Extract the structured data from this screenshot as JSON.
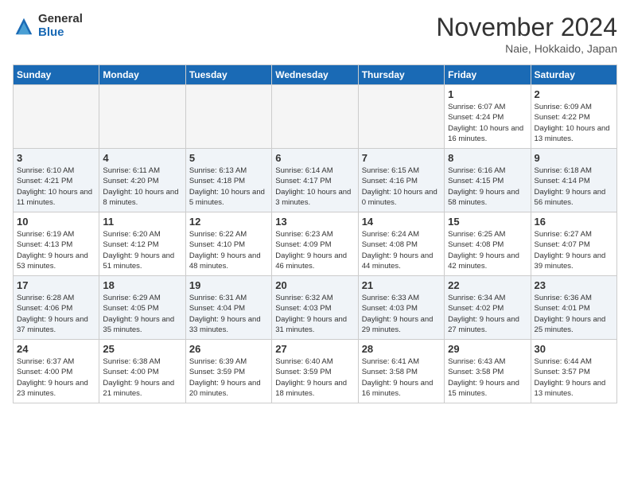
{
  "logo": {
    "general": "General",
    "blue": "Blue"
  },
  "title": "November 2024",
  "location": "Naie, Hokkaido, Japan",
  "days_of_week": [
    "Sunday",
    "Monday",
    "Tuesday",
    "Wednesday",
    "Thursday",
    "Friday",
    "Saturday"
  ],
  "weeks": [
    [
      {
        "day": "",
        "info": ""
      },
      {
        "day": "",
        "info": ""
      },
      {
        "day": "",
        "info": ""
      },
      {
        "day": "",
        "info": ""
      },
      {
        "day": "",
        "info": ""
      },
      {
        "day": "1",
        "info": "Sunrise: 6:07 AM\nSunset: 4:24 PM\nDaylight: 10 hours and 16 minutes."
      },
      {
        "day": "2",
        "info": "Sunrise: 6:09 AM\nSunset: 4:22 PM\nDaylight: 10 hours and 13 minutes."
      }
    ],
    [
      {
        "day": "3",
        "info": "Sunrise: 6:10 AM\nSunset: 4:21 PM\nDaylight: 10 hours and 11 minutes."
      },
      {
        "day": "4",
        "info": "Sunrise: 6:11 AM\nSunset: 4:20 PM\nDaylight: 10 hours and 8 minutes."
      },
      {
        "day": "5",
        "info": "Sunrise: 6:13 AM\nSunset: 4:18 PM\nDaylight: 10 hours and 5 minutes."
      },
      {
        "day": "6",
        "info": "Sunrise: 6:14 AM\nSunset: 4:17 PM\nDaylight: 10 hours and 3 minutes."
      },
      {
        "day": "7",
        "info": "Sunrise: 6:15 AM\nSunset: 4:16 PM\nDaylight: 10 hours and 0 minutes."
      },
      {
        "day": "8",
        "info": "Sunrise: 6:16 AM\nSunset: 4:15 PM\nDaylight: 9 hours and 58 minutes."
      },
      {
        "day": "9",
        "info": "Sunrise: 6:18 AM\nSunset: 4:14 PM\nDaylight: 9 hours and 56 minutes."
      }
    ],
    [
      {
        "day": "10",
        "info": "Sunrise: 6:19 AM\nSunset: 4:13 PM\nDaylight: 9 hours and 53 minutes."
      },
      {
        "day": "11",
        "info": "Sunrise: 6:20 AM\nSunset: 4:12 PM\nDaylight: 9 hours and 51 minutes."
      },
      {
        "day": "12",
        "info": "Sunrise: 6:22 AM\nSunset: 4:10 PM\nDaylight: 9 hours and 48 minutes."
      },
      {
        "day": "13",
        "info": "Sunrise: 6:23 AM\nSunset: 4:09 PM\nDaylight: 9 hours and 46 minutes."
      },
      {
        "day": "14",
        "info": "Sunrise: 6:24 AM\nSunset: 4:08 PM\nDaylight: 9 hours and 44 minutes."
      },
      {
        "day": "15",
        "info": "Sunrise: 6:25 AM\nSunset: 4:08 PM\nDaylight: 9 hours and 42 minutes."
      },
      {
        "day": "16",
        "info": "Sunrise: 6:27 AM\nSunset: 4:07 PM\nDaylight: 9 hours and 39 minutes."
      }
    ],
    [
      {
        "day": "17",
        "info": "Sunrise: 6:28 AM\nSunset: 4:06 PM\nDaylight: 9 hours and 37 minutes."
      },
      {
        "day": "18",
        "info": "Sunrise: 6:29 AM\nSunset: 4:05 PM\nDaylight: 9 hours and 35 minutes."
      },
      {
        "day": "19",
        "info": "Sunrise: 6:31 AM\nSunset: 4:04 PM\nDaylight: 9 hours and 33 minutes."
      },
      {
        "day": "20",
        "info": "Sunrise: 6:32 AM\nSunset: 4:03 PM\nDaylight: 9 hours and 31 minutes."
      },
      {
        "day": "21",
        "info": "Sunrise: 6:33 AM\nSunset: 4:03 PM\nDaylight: 9 hours and 29 minutes."
      },
      {
        "day": "22",
        "info": "Sunrise: 6:34 AM\nSunset: 4:02 PM\nDaylight: 9 hours and 27 minutes."
      },
      {
        "day": "23",
        "info": "Sunrise: 6:36 AM\nSunset: 4:01 PM\nDaylight: 9 hours and 25 minutes."
      }
    ],
    [
      {
        "day": "24",
        "info": "Sunrise: 6:37 AM\nSunset: 4:00 PM\nDaylight: 9 hours and 23 minutes."
      },
      {
        "day": "25",
        "info": "Sunrise: 6:38 AM\nSunset: 4:00 PM\nDaylight: 9 hours and 21 minutes."
      },
      {
        "day": "26",
        "info": "Sunrise: 6:39 AM\nSunset: 3:59 PM\nDaylight: 9 hours and 20 minutes."
      },
      {
        "day": "27",
        "info": "Sunrise: 6:40 AM\nSunset: 3:59 PM\nDaylight: 9 hours and 18 minutes."
      },
      {
        "day": "28",
        "info": "Sunrise: 6:41 AM\nSunset: 3:58 PM\nDaylight: 9 hours and 16 minutes."
      },
      {
        "day": "29",
        "info": "Sunrise: 6:43 AM\nSunset: 3:58 PM\nDaylight: 9 hours and 15 minutes."
      },
      {
        "day": "30",
        "info": "Sunrise: 6:44 AM\nSunset: 3:57 PM\nDaylight: 9 hours and 13 minutes."
      }
    ]
  ]
}
